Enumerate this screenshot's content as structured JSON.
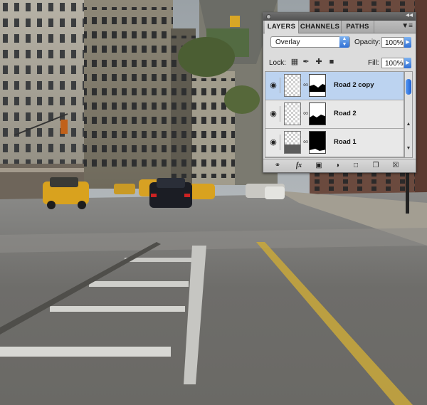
{
  "panel": {
    "tabs": [
      {
        "label": "LAYERS",
        "active": true
      },
      {
        "label": "CHANNELS",
        "active": false
      },
      {
        "label": "PATHS",
        "active": false
      }
    ],
    "blend_mode": "Overlay",
    "opacity_label": "Opacity:",
    "opacity_value": "100%",
    "lock_label": "Lock:",
    "fill_label": "Fill:",
    "fill_value": "100%",
    "layers": [
      {
        "name": "Road 2 copy",
        "visible": true,
        "selected": true
      },
      {
        "name": "Road 2",
        "visible": true,
        "selected": false
      },
      {
        "name": "Road 1",
        "visible": true,
        "selected": false
      }
    ],
    "footer_icons": [
      "link-layers-icon",
      "fx-icon",
      "add-mask-icon",
      "adjustment-layer-icon",
      "new-group-icon",
      "new-layer-icon",
      "trash-icon"
    ],
    "colors": {
      "selected_row": "#bcd3f0",
      "accent_blue": "#2f6fd4"
    }
  }
}
